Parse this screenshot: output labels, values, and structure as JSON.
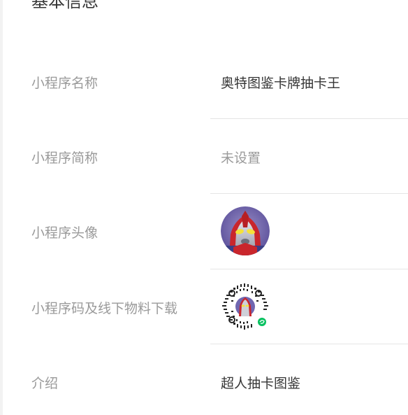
{
  "section": {
    "title": "基本信息"
  },
  "rows": [
    {
      "label": "小程序名称",
      "value": "奥特图鉴卡牌抽卡王"
    },
    {
      "label": "小程序简称",
      "value": "未设置"
    },
    {
      "label": "小程序头像"
    },
    {
      "label": "小程序码及线下物料下载"
    },
    {
      "label": "介绍",
      "value": "超人抽卡图鉴"
    }
  ],
  "colors": {
    "label": "#9a9a9a",
    "value": "#353535",
    "divider": "#e5e5e5",
    "wechat_badge": "#07c160"
  },
  "icons": {
    "avatar": "ultraman-avatar-image",
    "qrcode": "mini-program-code-image"
  }
}
